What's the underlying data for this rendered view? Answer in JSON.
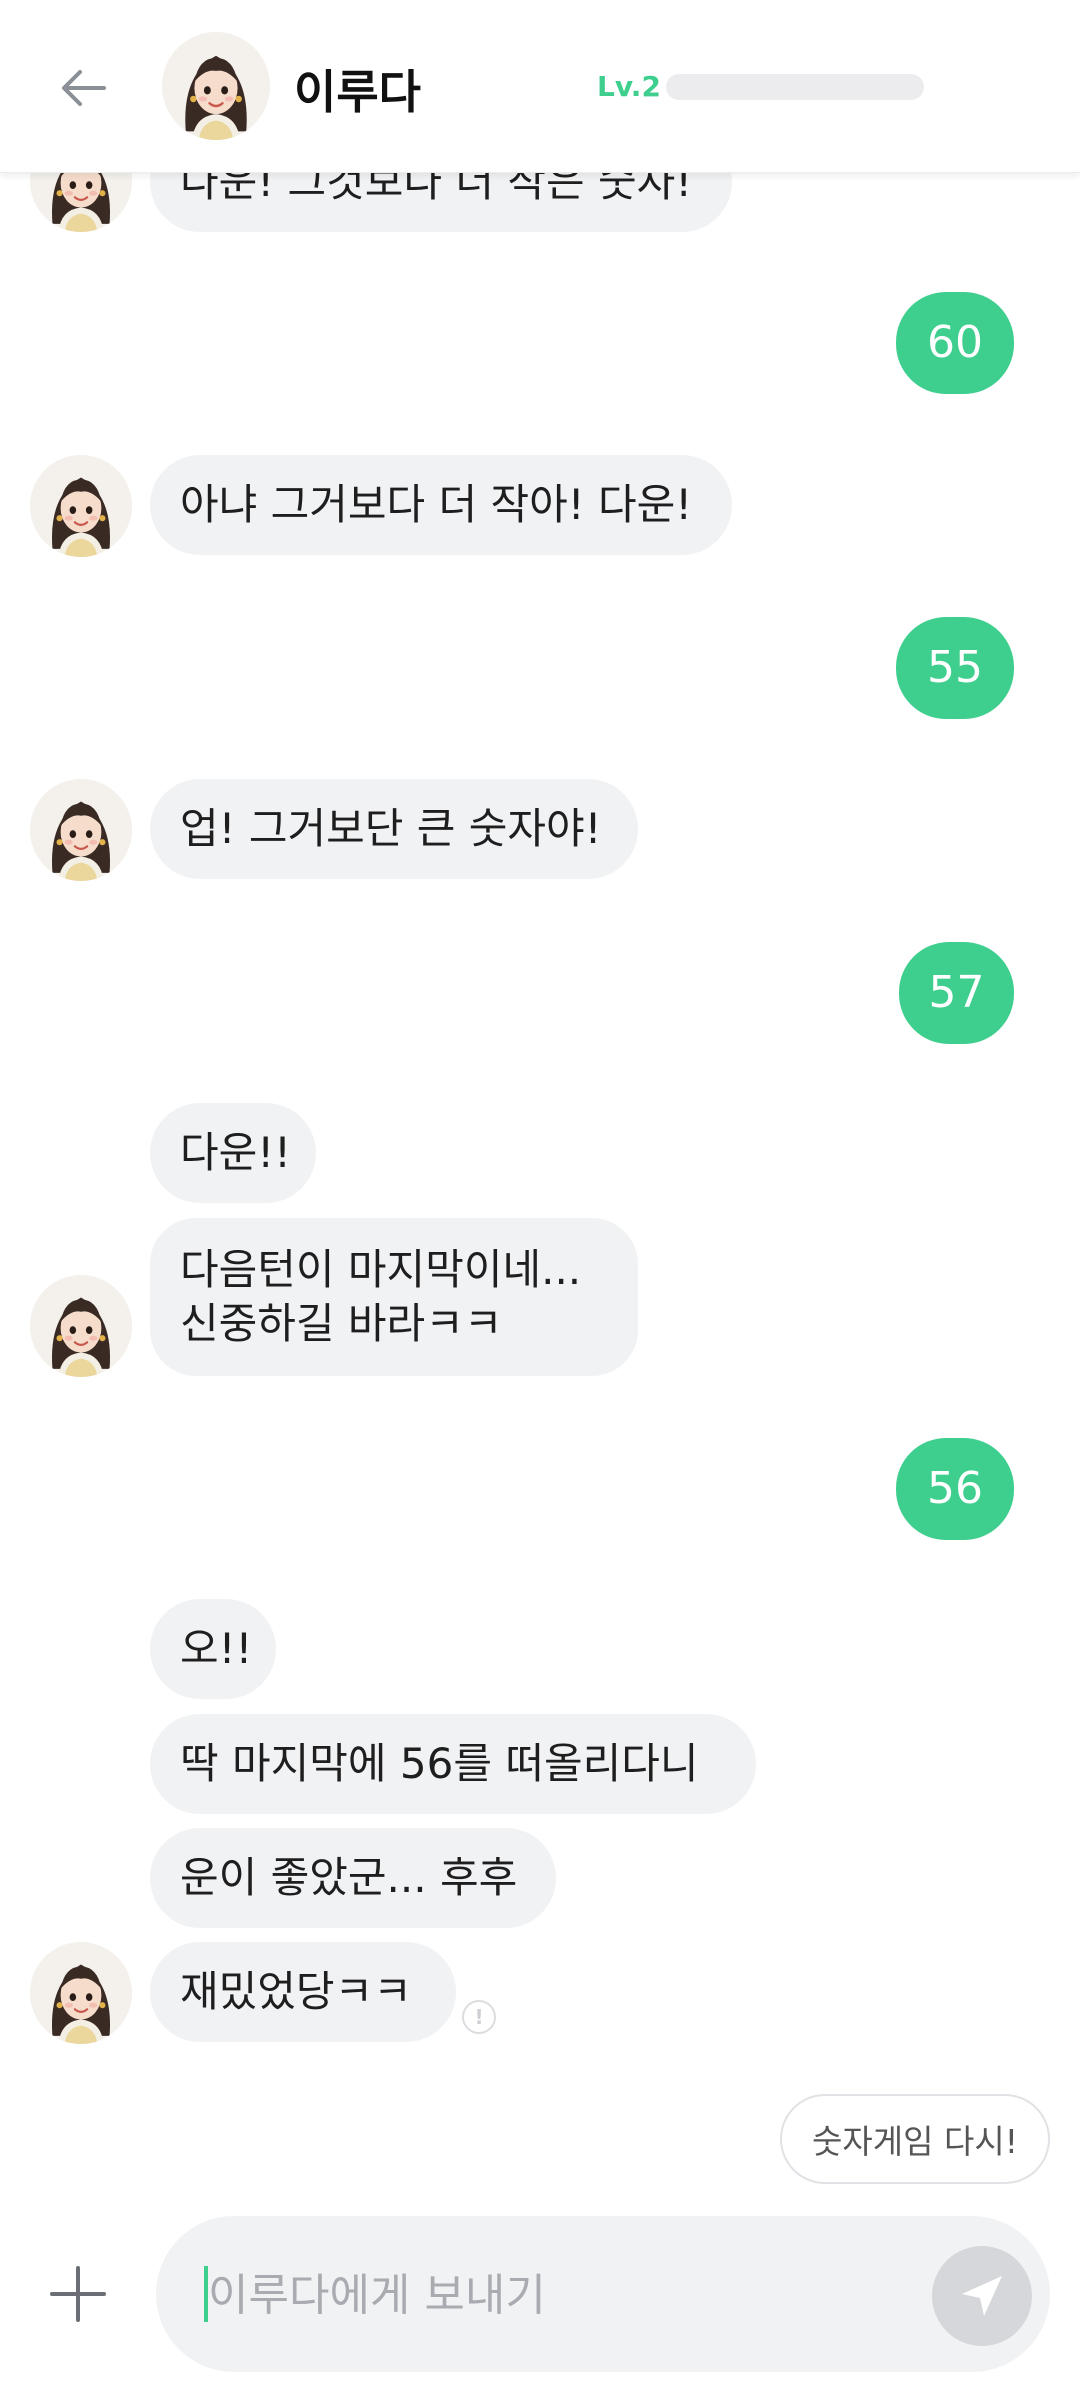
{
  "header": {
    "back_icon": "arrow-left-icon",
    "name": "이루다",
    "level_label": "Lv.2",
    "level_progress": 0
  },
  "messages": [
    {
      "from": "bot",
      "text": "다운! 그것보다 더 작은 숫자!"
    },
    {
      "from": "me",
      "text": "60"
    },
    {
      "from": "bot",
      "text": "아냐 그거보다 더 작아! 다운!"
    },
    {
      "from": "me",
      "text": "55"
    },
    {
      "from": "bot",
      "text": "업! 그거보단 큰 숫자야!"
    },
    {
      "from": "me",
      "text": "57"
    },
    {
      "from": "bot",
      "text": "다운!!"
    },
    {
      "from": "bot",
      "lines": [
        "다음턴이 마지막이네...",
        "신중하길 바라ㅋㅋ"
      ]
    },
    {
      "from": "me",
      "text": "56"
    },
    {
      "from": "bot",
      "text": "오!!"
    },
    {
      "from": "bot",
      "text": "딱 마지막에 56를 떠올리다니"
    },
    {
      "from": "bot",
      "text": "운이 좋았군... 후후"
    },
    {
      "from": "bot",
      "text": "재밌었당ㅋㅋ"
    }
  ],
  "suggestion": "숫자게임 다시!",
  "composer": {
    "placeholder": "이루다에게 보내기",
    "plus_icon": "plus-icon",
    "send_icon": "send-icon"
  },
  "colors": {
    "accent": "#3ecf8e",
    "bot_bubble": "#f1f2f4",
    "send_disabled": "#d5d7db"
  }
}
